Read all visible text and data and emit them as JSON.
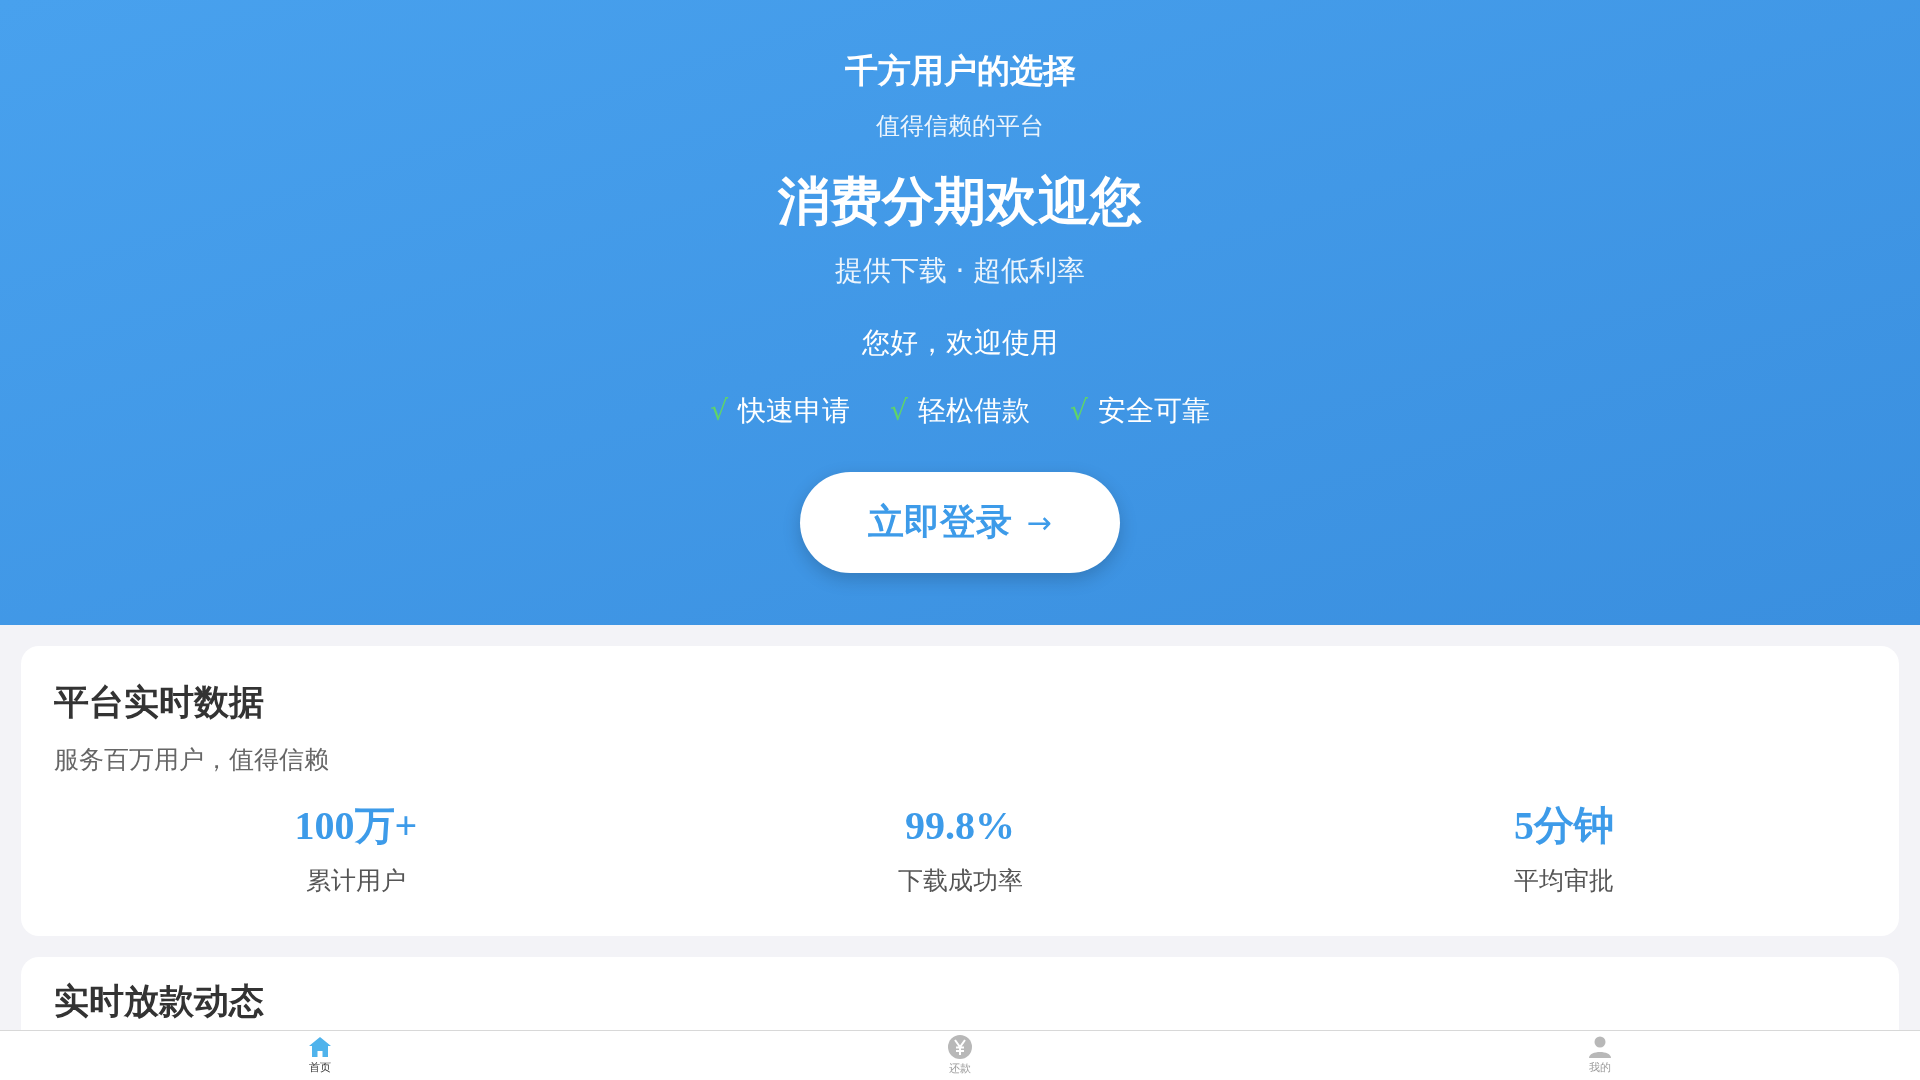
{
  "hero": {
    "title": "千方用户的选择",
    "subtitle": "值得信赖的平台",
    "headline": "消费分期欢迎您",
    "tagline": "提供下载 · 超低利率",
    "greeting": "您好，欢迎使用",
    "features": [
      {
        "mark": "√",
        "label": "快速申请"
      },
      {
        "mark": "√",
        "label": "轻松借款"
      },
      {
        "mark": "√",
        "label": "安全可靠"
      }
    ],
    "login_button": {
      "label": "立即登录",
      "arrow": "→"
    }
  },
  "stats_card": {
    "title": "平台实时数据",
    "subtitle": "服务百万用户，值得信赖",
    "stats": [
      {
        "value": "100万+",
        "label": "累计用户"
      },
      {
        "value": "99.8%",
        "label": "下载成功率"
      },
      {
        "value": "5分钟",
        "label": "平均审批"
      }
    ]
  },
  "loans_card": {
    "title": "实时放款动态"
  },
  "bottom_nav": [
    {
      "kind": "home",
      "label": "首页",
      "selected": true
    },
    {
      "kind": "yuan",
      "label": "还款",
      "selected": false
    },
    {
      "kind": "user",
      "label": "我的",
      "selected": false
    }
  ]
}
